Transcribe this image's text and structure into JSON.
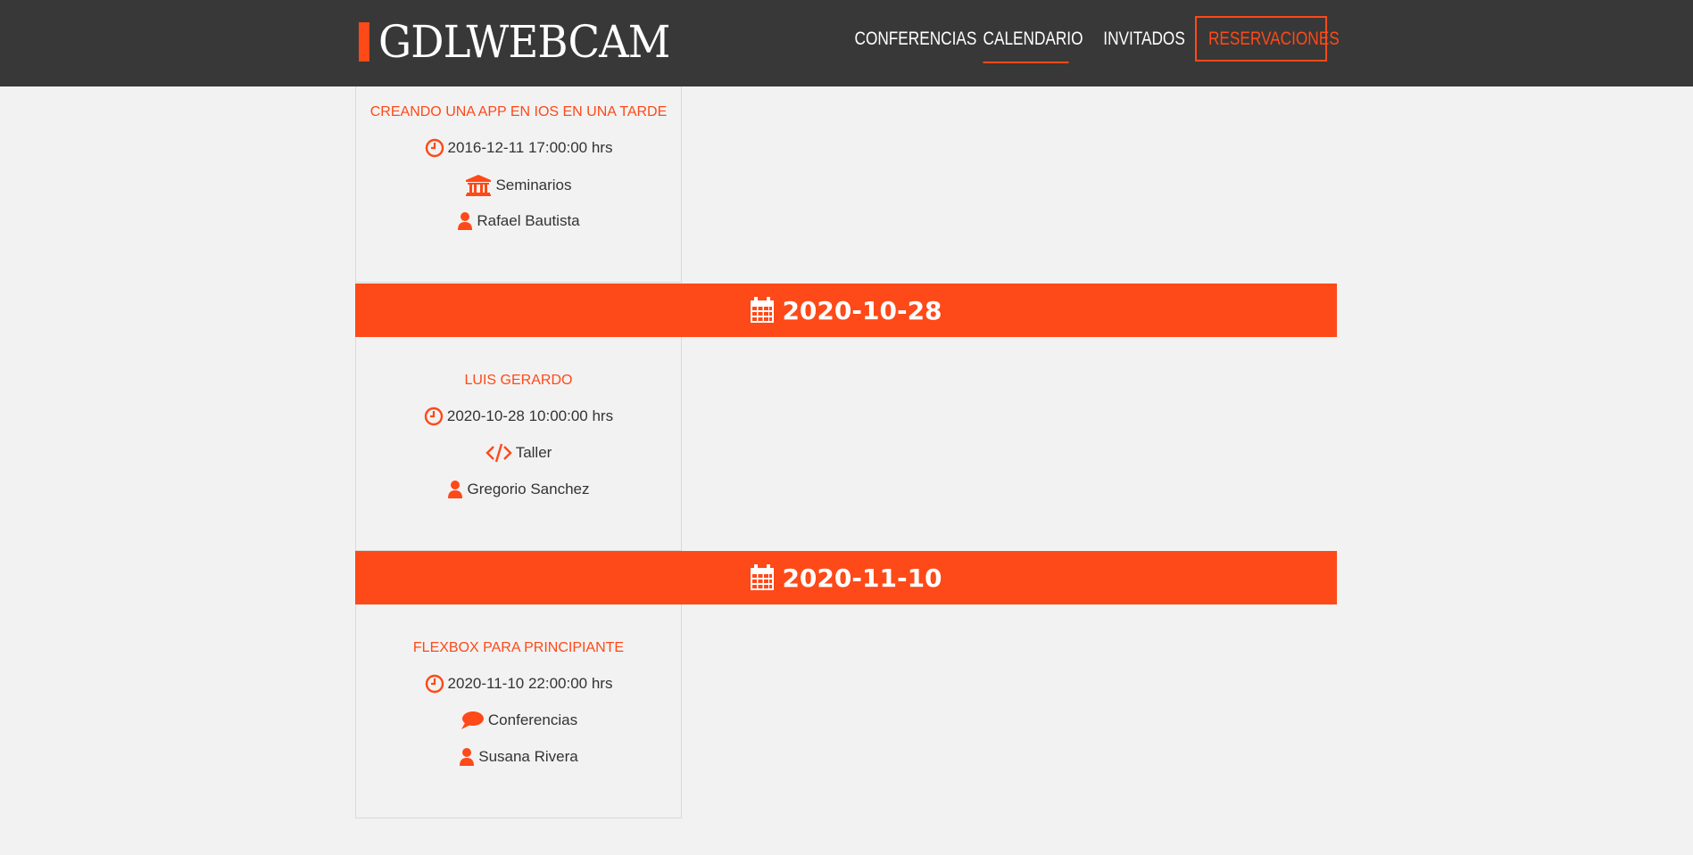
{
  "header": {
    "logo_text": "GDLWEBCAM",
    "nav": [
      {
        "label": "CONFERENCIAS",
        "active": false
      },
      {
        "label": "CALENDARIO",
        "active": true
      },
      {
        "label": "INVITADOS",
        "active": false
      },
      {
        "label": "RESERVACIONES",
        "active": false
      }
    ]
  },
  "colors": {
    "accent": "#fe4918",
    "header_bg": "#383838",
    "page_bg": "#f2f2f2"
  },
  "events": [
    {
      "title": "CREANDO UNA APP EN IOS EN UNA TARDE",
      "datetime": "2016-12-11 17:00:00 hrs",
      "category": "Seminarios",
      "category_icon": "university-icon",
      "speaker": "Rafael Bautista"
    },
    {
      "title": "LUIS GERARDO",
      "datetime": "2020-10-28 10:00:00 hrs",
      "category": "Taller",
      "category_icon": "code-icon",
      "speaker": "Gregorio Sanchez"
    },
    {
      "title": "FLEXBOX PARA PRINCIPIANTE",
      "datetime": "2020-11-10 22:00:00 hrs",
      "category": "Conferencias",
      "category_icon": "comment-icon",
      "speaker": "Susana Rivera"
    }
  ],
  "dates": [
    {
      "label": "2020-10-28"
    },
    {
      "label": "2020-11-10"
    }
  ]
}
